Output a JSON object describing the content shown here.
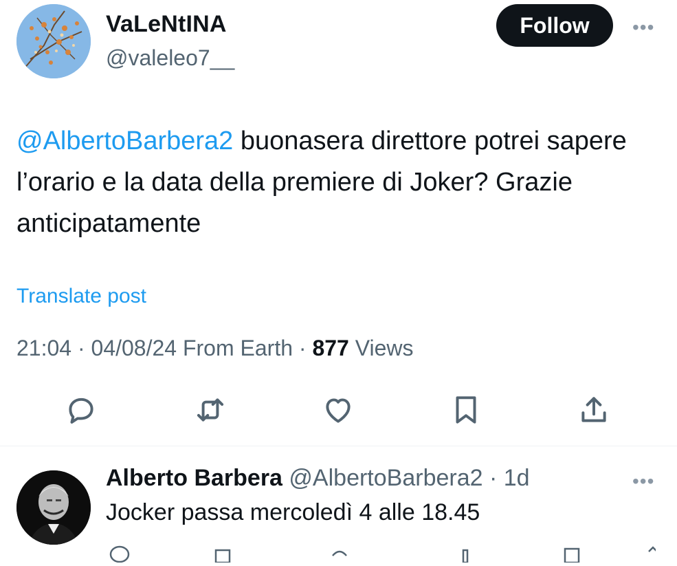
{
  "post": {
    "author_name": "VaLeNtINA",
    "author_handle": "@valeleo7__",
    "follow_label": "Follow",
    "more_label": "•••",
    "mention": "@AlbertoBarbera2",
    "text_after_mention": " buonasera direttore potrei sapere l’orario e la data della premiere di Joker? Grazie anticipatamente",
    "translate_label": "Translate post",
    "meta_time": "21:04",
    "meta_sep1": " · ",
    "meta_date": "04/08/24",
    "meta_from": " From Earth",
    "meta_sep2": " · ",
    "views_count": "877",
    "views_label": " Views"
  },
  "actions": [
    "reply-icon",
    "repost-icon",
    "like-icon",
    "bookmark-icon",
    "share-icon"
  ],
  "reply": {
    "author_name": "Alberto Barbera",
    "author_handle": " @AlbertoBarbera2",
    "sep": " · ",
    "age": "1d",
    "more_label": "•••",
    "text": "Jocker passa mercoledì 4 alle 18.45"
  },
  "colors": {
    "link": "#1d9bf0",
    "secondary_text": "#536471",
    "primary_text": "#0f1419",
    "follow_bg": "#0f1419",
    "icon": "#536471"
  }
}
